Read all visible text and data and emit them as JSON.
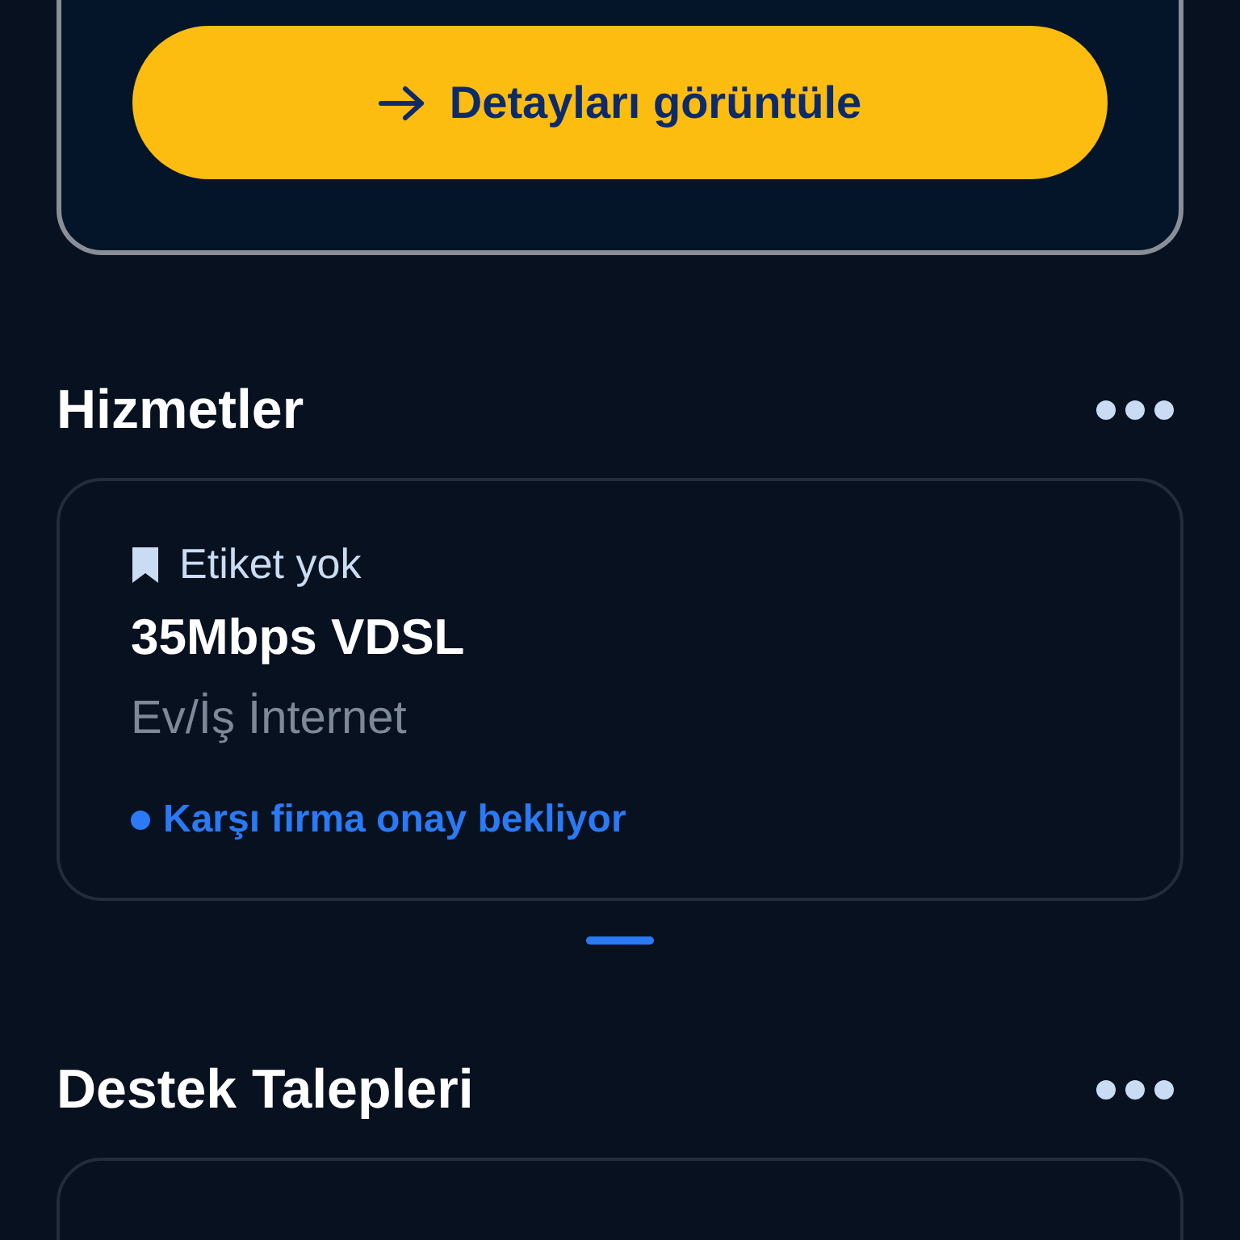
{
  "top_card": {
    "button": {
      "label": "Detayları görüntüle"
    }
  },
  "sections": [
    {
      "title": "Hizmetler",
      "cards": [
        {
          "tag": "Etiket yok",
          "name": "35Mbps VDSL",
          "category": "Ev/İş İnternet",
          "status": "Karşı firma onay bekliyor"
        }
      ]
    },
    {
      "title": "Destek Talepleri"
    }
  ]
}
